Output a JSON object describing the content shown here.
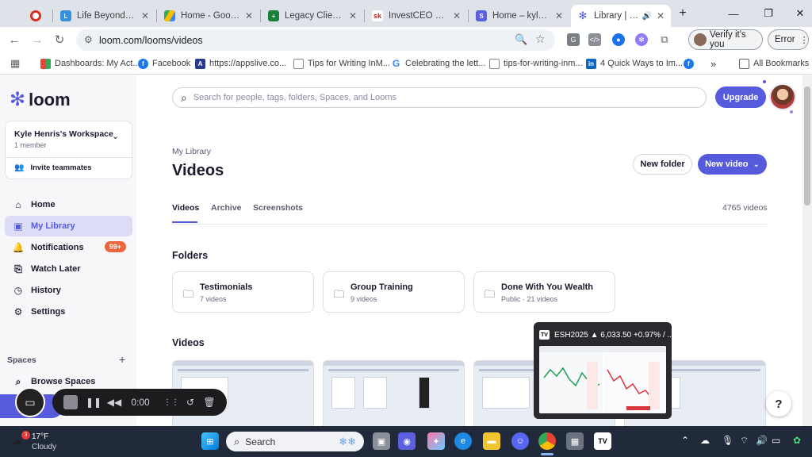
{
  "browser": {
    "tabs": [
      {
        "title": "",
        "icon": "record-icon"
      },
      {
        "title": "Life Beyond Latte",
        "icon": "site-favicon"
      },
      {
        "title": "Home - Google D",
        "icon": "google-drive-icon"
      },
      {
        "title": "Legacy Client Act",
        "icon": "google-sheets-icon"
      },
      {
        "title": "InvestCEO Board",
        "icon": "investceo-icon"
      },
      {
        "title": "Home – kylehenr",
        "icon": "s-favicon"
      },
      {
        "title": "Library | Loom",
        "icon": "loom-icon",
        "active": true
      }
    ],
    "new_tab": "+",
    "url": "loom.com/looms/videos",
    "verify_label": "Verify it's you",
    "error_label": "Error",
    "bookmarks": [
      "Dashboards: My Act...",
      "Facebook",
      "https://appslive.co...",
      "Tips for Writing InM...",
      "Celebrating the lett...",
      "tips-for-writing-inm...",
      "4 Quick Ways to Im..."
    ],
    "bookmarks_more": "»",
    "all_bookmarks": "All Bookmarks"
  },
  "app": {
    "logo_text": "loom",
    "search_placeholder": "Search for people, tags, folders, Spaces, and Looms",
    "upgrade_label": "Upgrade",
    "workspace": {
      "name": "Kyle Henris's Workspace",
      "members": "1 member",
      "invite": "Invite teammates"
    },
    "nav": [
      {
        "label": "Home",
        "icon": "home-icon"
      },
      {
        "label": "My Library",
        "icon": "library-icon",
        "selected": true
      },
      {
        "label": "Notifications",
        "icon": "bell-icon",
        "badge": "99+"
      },
      {
        "label": "Watch Later",
        "icon": "bookmark-icon"
      },
      {
        "label": "History",
        "icon": "clock-icon"
      },
      {
        "label": "Settings",
        "icon": "gear-icon"
      }
    ],
    "spaces_title": "Spaces",
    "browse_spaces": "Browse Spaces",
    "breadcrumb": "My Library",
    "page_title": "Videos",
    "new_folder_label": "New folder",
    "new_video_label": "New video",
    "tabs": [
      "Videos",
      "Archive",
      "Screenshots"
    ],
    "video_count": "4765 videos",
    "folders_title": "Folders",
    "folders": [
      {
        "name": "Testimonials",
        "sub": "7 videos"
      },
      {
        "name": "Group Training",
        "sub": "9 videos"
      },
      {
        "name": "Done With You Wealth",
        "sub": "Public · 21 videos"
      }
    ],
    "videos_title": "Videos",
    "help_label": "?"
  },
  "recorder": {
    "time": "0:00"
  },
  "tv_popup": {
    "title": "ESH2025 ▲ 6,033.50 +0.97% / ..."
  },
  "taskbar": {
    "weather_temp": "17°F",
    "weather_desc": "Cloudy",
    "weather_badge": "3",
    "search_label": "Search"
  },
  "colors": {
    "accent": "#565add",
    "badge": "#f0643c",
    "taskbar": "#202a3a"
  }
}
